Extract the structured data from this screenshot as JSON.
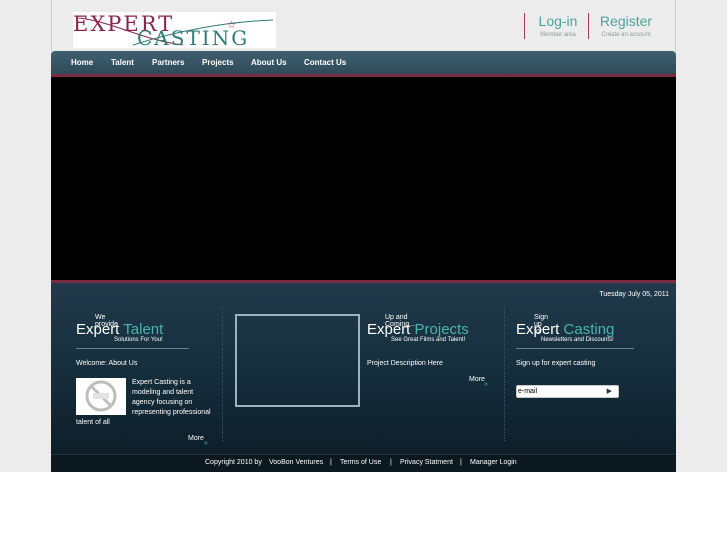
{
  "header": {
    "logo": {
      "line1": "EXPERT",
      "line2": "CASTING"
    },
    "login": {
      "label": "Log-in",
      "sub": "Member area"
    },
    "register": {
      "label": "Register",
      "sub": "Create an account"
    }
  },
  "nav": {
    "items": [
      {
        "label": "Home"
      },
      {
        "label": "Talent"
      },
      {
        "label": "Partners"
      },
      {
        "label": "Projects"
      },
      {
        "label": "About Us"
      },
      {
        "label": "Contact Us"
      }
    ]
  },
  "date": "Tuesday July 05, 2011",
  "talent": {
    "pre": "We provide",
    "word1": "Expert",
    "word2": "Talent",
    "post": "Solutions For You!",
    "welcome": "Welcome: About Us",
    "body": "Expert Casting is a modeling and talent agency focusing on representing professional",
    "body_tail": "talent of all",
    "more": "More"
  },
  "projects": {
    "pre": "Up and Coming...",
    "word1": "Expert",
    "word2": "Projects",
    "post": "See Great Films and Talent!",
    "description": "Project Description Here",
    "more": "More"
  },
  "signup": {
    "pre": "Sign up for",
    "word1": "Expert",
    "word2": "Casting",
    "post": "Newsletters and Discounts!",
    "text": "Sign up for expert casting",
    "email_placeholder": "e-mail"
  },
  "footer": {
    "copyright": "Copyright 2010 by",
    "company": "VooBon Ventures",
    "sep": "|",
    "terms": "Terms of Use",
    "privacy": "Privacy Statment",
    "manager": "Manager Login"
  },
  "colors": {
    "accent_teal": "#4db3b0",
    "accent_maroon": "#7a2a42",
    "nav_bg": "#3f5f6f"
  },
  "icons": {
    "more": "more-arrow-icon",
    "submit": "play-arrow-icon",
    "no_image": "no-image-icon"
  }
}
